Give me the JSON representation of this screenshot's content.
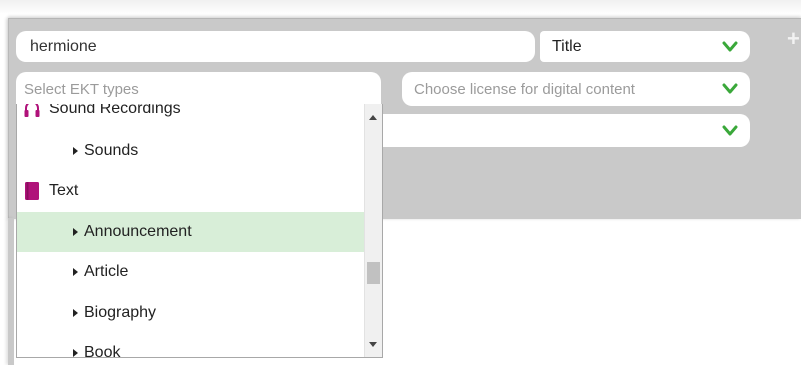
{
  "search": {
    "value": "hermione"
  },
  "field_select": {
    "selected": "Title"
  },
  "ekt_types": {
    "placeholder": "Select EKT types"
  },
  "license_select": {
    "placeholder": "Choose license for digital content"
  },
  "third_select": {
    "selected": ""
  },
  "dropdown": {
    "categories": [
      {
        "label": "Sound Recordings",
        "icon": "headphones-icon"
      },
      {
        "label": "Text",
        "icon": "book-icon"
      }
    ],
    "items": {
      "sounds": "Sounds",
      "announcement": "Announcement",
      "article": "Article",
      "biography": "Biography",
      "book": "Book"
    },
    "highlighted": "Announcement",
    "scroll_position": 0.6
  },
  "colors": {
    "accent_green": "#3aa83a",
    "icon_magenta": "#b0127a",
    "highlight": "#d8eed8",
    "panel": "#c9c9c9"
  }
}
